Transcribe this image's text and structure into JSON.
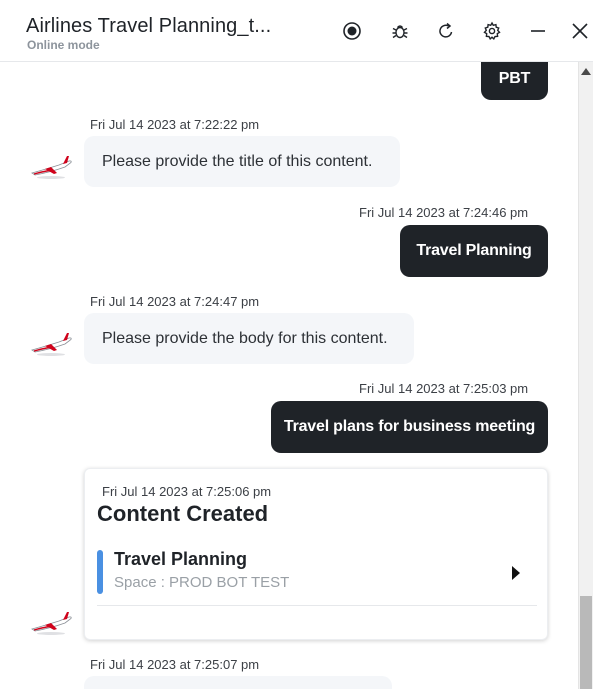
{
  "header": {
    "title": "Airlines Travel Planning_t...",
    "subtitle": "Online mode",
    "icons": [
      "record-icon",
      "bug-icon",
      "refresh-icon",
      "gear-icon",
      "minimize-icon",
      "close-icon"
    ]
  },
  "messages": [
    {
      "sender": "user",
      "text": "PBT"
    },
    {
      "sender": "bot",
      "timestamp": "Fri Jul 14 2023 at 7:22:22 pm",
      "text": "Please provide the title of this content."
    },
    {
      "sender": "user",
      "timestamp": "Fri Jul 14 2023 at 7:24:46 pm",
      "text": "Travel Planning"
    },
    {
      "sender": "bot",
      "timestamp": "Fri Jul 14 2023 at 7:24:47 pm",
      "text": "Please provide the body for this content."
    },
    {
      "sender": "user",
      "timestamp": "Fri Jul 14 2023 at 7:25:03 pm",
      "text": "Travel plans for business meeting"
    },
    {
      "sender": "bot",
      "timestamp": "Fri Jul 14 2023 at 7:25:07 pm",
      "text": ""
    }
  ],
  "card": {
    "timestamp": "Fri Jul 14 2023 at 7:25:06 pm",
    "title": "Content Created",
    "item_title": "Travel Planning",
    "item_subtitle": "Space : PROD BOT TEST",
    "accent_color": "#4a90e2"
  },
  "colors": {
    "user_bubble": "#1f2328",
    "bot_bubble": "#f4f6f9"
  }
}
